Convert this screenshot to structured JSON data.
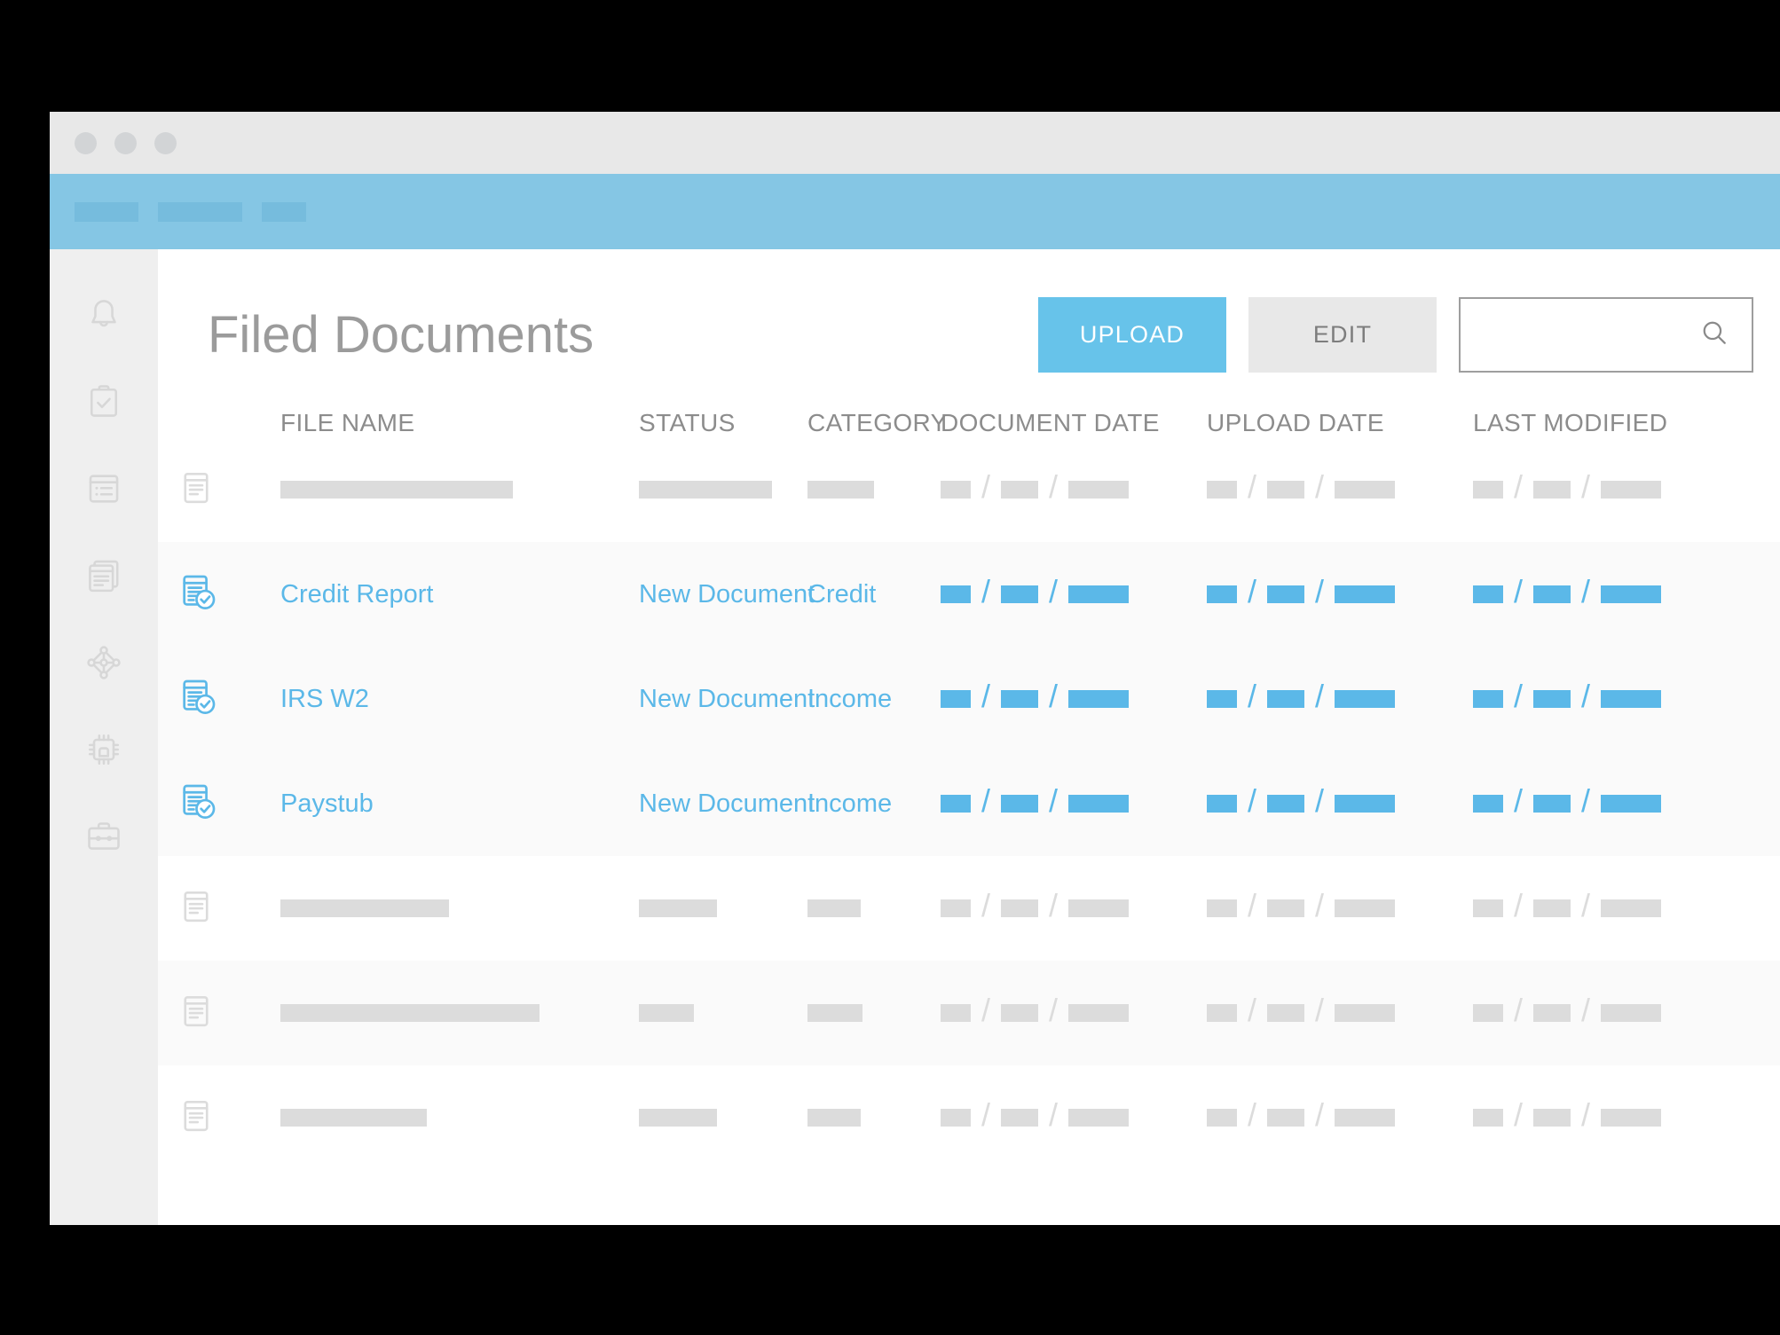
{
  "window": {
    "traffic_lights": [
      "close",
      "minimize",
      "maximize"
    ],
    "navbar_placeholders": [
      "w1",
      "w2",
      "w3"
    ],
    "chrome_color": "#e8e8e8",
    "navbar_color": "#85c6e4"
  },
  "sidebar": {
    "items": [
      {
        "name": "notifications",
        "icon": "bell-icon"
      },
      {
        "name": "tasks",
        "icon": "clipboard-check-icon"
      },
      {
        "name": "list",
        "icon": "list-document-icon"
      },
      {
        "name": "documents",
        "icon": "stacked-documents-icon"
      },
      {
        "name": "network",
        "icon": "network-nodes-icon"
      },
      {
        "name": "processing",
        "icon": "cpu-chip-icon"
      },
      {
        "name": "portfolio",
        "icon": "briefcase-icon"
      }
    ]
  },
  "page": {
    "title": "Filed Documents",
    "accent_color": "#5bb8e8"
  },
  "toolbar": {
    "upload_label": "UPLOAD",
    "edit_label": "EDIT"
  },
  "search": {
    "value": "",
    "placeholder": "",
    "icon": "search-icon"
  },
  "table": {
    "headers": {
      "file_name": "FILE NAME",
      "status": "STATUS",
      "category": "CATEGORY",
      "document_date": "DOCUMENT DATE",
      "upload_date": "UPLOAD DATE",
      "last_modified": "LAST MODIFIED"
    },
    "rows": [
      {
        "state": "placeholder",
        "icon": "document-icon",
        "file_name": "",
        "status": "",
        "category": "",
        "name_bar_width": 262,
        "status_bar_width": 150,
        "category_bar_width": 75,
        "shaded": false
      },
      {
        "state": "active",
        "icon": "document-check-icon",
        "file_name": "Credit Report",
        "status": "New Document",
        "category": "Credit",
        "shaded": true
      },
      {
        "state": "active",
        "icon": "document-check-icon",
        "file_name": "IRS W2",
        "status": "New Document",
        "category": "Income",
        "shaded": false
      },
      {
        "state": "active",
        "icon": "document-check-icon",
        "file_name": "Paystub",
        "status": "New Document",
        "category": "Income",
        "shaded": true
      },
      {
        "state": "placeholder",
        "icon": "document-icon",
        "file_name": "",
        "status": "",
        "category": "",
        "name_bar_width": 190,
        "status_bar_width": 88,
        "category_bar_width": 60,
        "shaded": false
      },
      {
        "state": "placeholder",
        "icon": "document-icon",
        "file_name": "",
        "status": "",
        "category": "",
        "name_bar_width": 292,
        "status_bar_width": 62,
        "category_bar_width": 62,
        "shaded": true
      },
      {
        "state": "placeholder",
        "icon": "document-icon",
        "file_name": "",
        "status": "",
        "category": "",
        "name_bar_width": 165,
        "status_bar_width": 88,
        "category_bar_width": 60,
        "shaded": false
      }
    ],
    "date_format_segments": [
      "MM",
      "DD",
      "YYYY"
    ],
    "date_separator": "/"
  }
}
